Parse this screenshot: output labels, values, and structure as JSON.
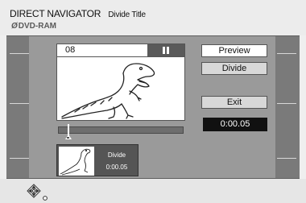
{
  "header": {
    "title": "DIRECT NAVIGATOR",
    "subtitle": "Divide Title",
    "disc_icon": "Ø",
    "disc_label": "DVD-RAM"
  },
  "preview": {
    "title_number": "08",
    "state": "paused",
    "icons": [
      "pause-icon",
      "dinosaur-image"
    ]
  },
  "progress": {
    "position_fraction": 0.08
  },
  "thumbnail": {
    "label": "Divide",
    "time": "0:00.05"
  },
  "buttons": {
    "preview": "Preview",
    "divide": "Divide",
    "exit": "Exit"
  },
  "time_display": "0:00.05",
  "footer": {
    "icon": "navigation-cross-icon"
  }
}
